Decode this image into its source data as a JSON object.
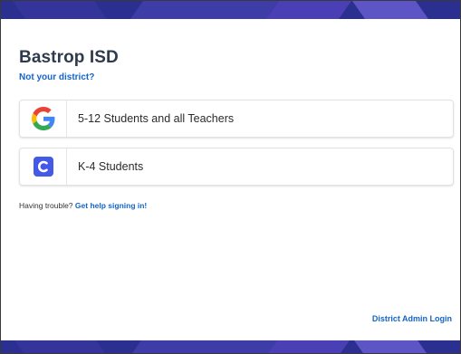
{
  "district": {
    "name": "Bastrop ISD",
    "not_your_district": "Not your district?"
  },
  "login_options": [
    {
      "label": "5-12 Students and all Teachers",
      "icon": "google-icon"
    },
    {
      "label": "K-4 Students",
      "icon": "clever-icon"
    }
  ],
  "help": {
    "prefix": "Having trouble?",
    "link_label": "Get help signing in!"
  },
  "footer": {
    "admin_login": "District Admin Login"
  },
  "colors": {
    "link": "#1464c8",
    "heading": "#2f3b4c",
    "band": "#2b2f8f",
    "clever_blue": "#4559e8"
  }
}
